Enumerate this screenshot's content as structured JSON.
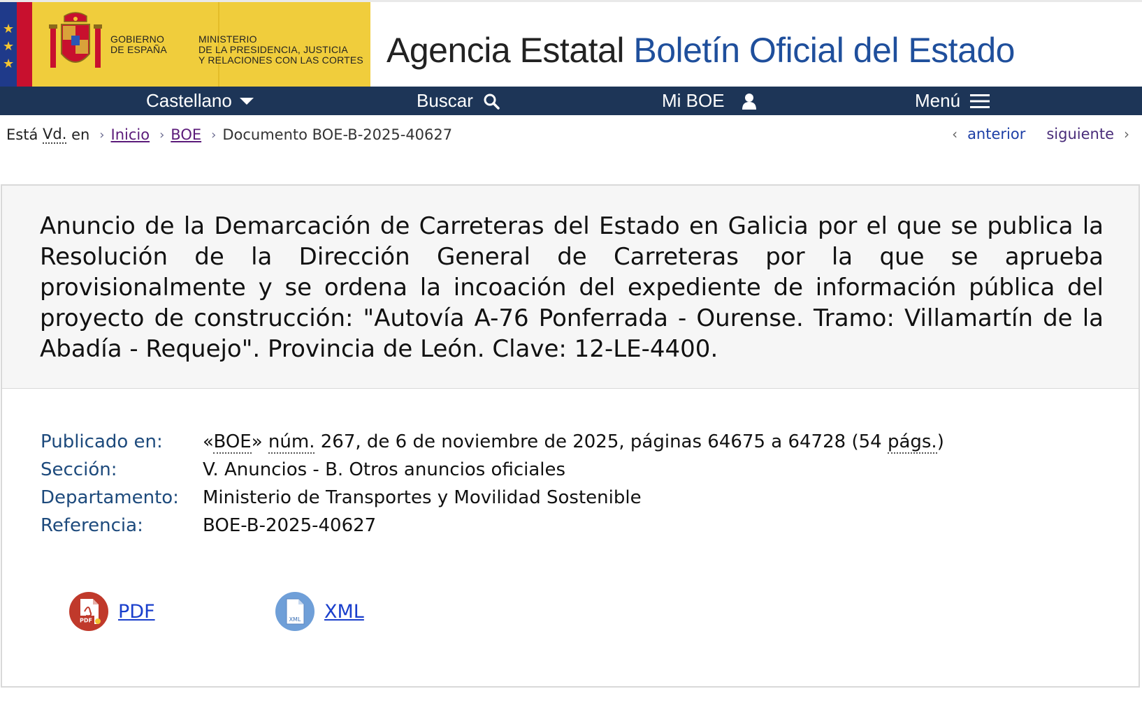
{
  "header": {
    "gov_line1": "GOBIERNO",
    "gov_line2": "DE ESPAÑA",
    "ministry_line1": "MINISTERIO",
    "ministry_line2": "DE LA PRESIDENCIA, JUSTICIA",
    "ministry_line3": "Y RELACIONES CON LAS CORTES",
    "agency_part1": "Agencia Estatal",
    "agency_part2": "Boletín Oficial del Estado"
  },
  "nav": {
    "language": "Castellano",
    "search": "Buscar",
    "my_boe": "Mi BOE",
    "menu": "Menú"
  },
  "breadcrumb": {
    "prefix": "Está",
    "abbr": "Vd.",
    "suffix": "en",
    "home": "Inicio",
    "boe": "BOE",
    "current": "Documento BOE-B-2025-40627"
  },
  "pager": {
    "previous": "anterior",
    "next": "siguiente"
  },
  "document": {
    "title": "Anuncio de la Demarcación de Carreteras del Estado en Galicia por el que se publica la Resolución de la Dirección General de Carreteras por la que se aprueba provisionalmente y se ordena la incoación del expediente de información pública del proyecto de construcción: \"Autovía A-76 Ponferrada - Ourense. Tramo: Villamartín de la Abadía - Requejo\". Provincia de León. Clave: 12-LE-4400."
  },
  "metadata": {
    "published_label": "Publicado en:",
    "published_boe_open": "«",
    "published_boe": "BOE",
    "published_boe_close": "»",
    "published_num_abbr": "núm.",
    "published_rest": "267, de 6 de noviembre de 2025, páginas 64675 a 64728 (54",
    "published_pags": "págs.",
    "published_end": ")",
    "section_label": "Sección:",
    "section_value": "V. Anuncios - B. Otros anuncios oficiales",
    "department_label": "Departamento:",
    "department_value": "Ministerio de Transportes y Movilidad Sostenible",
    "reference_label": "Referencia:",
    "reference_value": "BOE-B-2025-40627"
  },
  "downloads": {
    "pdf_label": "PDF",
    "pdf_icon_text": "PDF",
    "xml_label": "XML",
    "xml_icon_text": "XML"
  },
  "colors": {
    "nav_bg": "#1d3557",
    "gov_yellow": "#f0cd3c",
    "agency_blue": "#1f4f9c",
    "link_blue": "#1a3fcc",
    "visited_purple": "#5b1b7a",
    "pdf_red": "#c0392b",
    "xml_blue": "#6f9fd8"
  }
}
